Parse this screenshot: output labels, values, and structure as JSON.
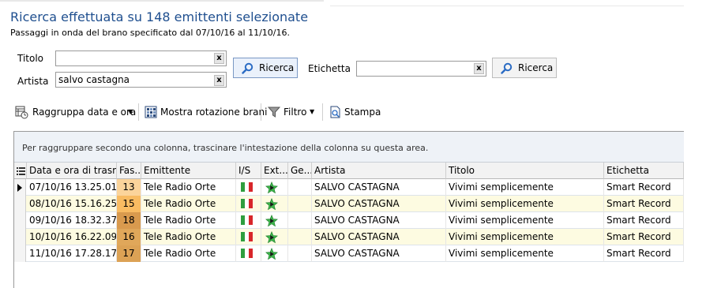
{
  "header": {
    "title": "Ricerca effettuata su 148 emittenti selezionate",
    "subtitle": "Passaggi in onda del brano specificato dal 07/10/16 al 11/10/16."
  },
  "search": {
    "titolo_label": "Titolo",
    "titolo_value": "",
    "artista_label": "Artista",
    "artista_value": "salvo castagna",
    "etichetta_label": "Etichetta",
    "etichetta_value": "",
    "clear_glyph": "x",
    "ricerca_label": "Ricerca"
  },
  "toolbar": {
    "group_label": "Raggruppa data e ora",
    "rotation_label": "Mostra rotazione brani",
    "filter_label": "Filtro",
    "print_label": "Stampa"
  },
  "grid": {
    "group_hint": "Per raggruppare secondo una colonna, trascinare l'intestazione della colonna su questa area.",
    "columns": [
      "Data e ora di trasm...",
      "Fas...",
      "Emittente",
      "I/S",
      "Ext...",
      "Ge...",
      "Artista",
      "Titolo",
      "Etichetta"
    ],
    "rows": [
      {
        "data": "07/10/16  13.25.01",
        "fascia": "13",
        "fascia_color": "#fbd49b",
        "emittente": "Tele Radio Orte",
        "artista": "SALVO CASTAGNA",
        "titolo": "Vivimi semplicemente",
        "etichetta": "Smart Record"
      },
      {
        "data": "08/10/16  15.16.25",
        "fascia": "15",
        "fascia_color": "#f8bb62",
        "emittente": "Tele Radio Orte",
        "artista": "SALVO CASTAGNA",
        "titolo": "Vivimi semplicemente",
        "etichetta": "Smart Record"
      },
      {
        "data": "09/10/16  18.32.37",
        "fascia": "18",
        "fascia_color": "#d99a4e",
        "emittente": "Tele Radio Orte",
        "artista": "SALVO CASTAGNA",
        "titolo": "Vivimi semplicemente",
        "etichetta": "Smart Record"
      },
      {
        "data": "10/10/16  16.22.09",
        "fascia": "16",
        "fascia_color": "#e0a75a",
        "emittente": "Tele Radio Orte",
        "artista": "SALVO CASTAGNA",
        "titolo": "Vivimi semplicemente",
        "etichetta": "Smart Record"
      },
      {
        "data": "11/10/16  17.28.17",
        "fascia": "17",
        "fascia_color": "#dca255",
        "emittente": "Tele Radio Orte",
        "artista": "SALVO CASTAGNA",
        "titolo": "Vivimi semplicemente",
        "etichetta": "Smart Record"
      }
    ]
  },
  "colors": {
    "title": "#1f4f8f",
    "flag_green": "#2e9e3e",
    "flag_white": "#ffffff",
    "flag_red": "#d8262a",
    "star_green": "#3cb54a"
  },
  "icons": [
    "search-icon",
    "group-icon",
    "rotation-icon",
    "filter-icon",
    "print-icon",
    "italy-flag-icon",
    "star-icon",
    "row-pointer-icon",
    "column-chooser-icon"
  ]
}
